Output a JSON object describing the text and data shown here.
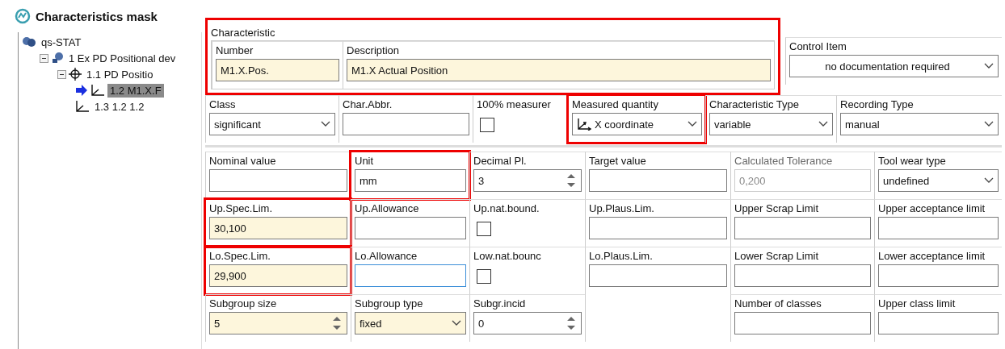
{
  "title": "Characteristics mask",
  "tree": [
    {
      "kind": "root",
      "label": "qs-STAT",
      "selected": false,
      "children": [
        {
          "kind": "part",
          "label": "1 Ex PD Positional dev",
          "selected": false,
          "expanded": true,
          "children": [
            {
              "kind": "process",
              "label": "1.1 PD Positio",
              "selected": false,
              "expanded": true,
              "children": [
                {
                  "kind": "characteristic",
                  "label": "1.2 M1.X.F",
                  "selected": true
                },
                {
                  "kind": "characteristic",
                  "label": "1.3 1.2 1.2",
                  "selected": false
                }
              ]
            }
          ]
        }
      ]
    }
  ],
  "characteristic_group": {
    "legend": "Characteristic",
    "highlighted": true,
    "fields": [
      {
        "kind": "text",
        "label": "Number",
        "value": "M1.X.Pos.",
        "required": true
      },
      {
        "kind": "text",
        "label": "Description",
        "value": "M1.X Actual Position",
        "required": true
      }
    ]
  },
  "control_item": {
    "kind": "select",
    "label": "Control Item",
    "value": "no documentation required",
    "centered": true
  },
  "row_2": [
    {
      "kind": "select",
      "label": "Class",
      "value": "significant"
    },
    {
      "kind": "text",
      "label": "Char.Abbr."
    },
    {
      "kind": "checkbox",
      "label": "100% measurer",
      "checked": false
    },
    {
      "kind": "select",
      "label": "Measured quantity",
      "value": "X coordinate",
      "axis_icon": true,
      "highlighted": true
    },
    {
      "kind": "select",
      "label": "Characteristic Type",
      "value": "variable"
    },
    {
      "kind": "select",
      "label": "Recording Type",
      "value": "manual"
    }
  ],
  "grid": [
    [
      {
        "kind": "text",
        "label": "Nominal value"
      },
      {
        "kind": "text",
        "label": "Unit",
        "value": "mm",
        "highlighted": true
      },
      {
        "kind": "spin",
        "label": "Decimal Pl.",
        "value": "3"
      },
      {
        "kind": "text",
        "label": "Target value"
      },
      {
        "kind": "text",
        "label": "Calculated Tolerance",
        "value": "0,200",
        "disabled": true
      },
      {
        "kind": "select",
        "label": "Tool wear type",
        "value": "undefined"
      }
    ],
    [
      {
        "kind": "text",
        "label": "Up.Spec.Lim.",
        "value": "30,100",
        "required": true,
        "highlighted": true
      },
      {
        "kind": "text",
        "label": "Up.Allowance"
      },
      {
        "kind": "checkbox",
        "label": "Up.nat.bound.",
        "checked": false
      },
      {
        "kind": "text",
        "label": "Up.Plaus.Lim."
      },
      {
        "kind": "text",
        "label": "Upper Scrap Limit"
      },
      {
        "kind": "text",
        "label": "Upper acceptance limit"
      }
    ],
    [
      {
        "kind": "text",
        "label": "Lo.Spec.Lim.",
        "value": "29,900",
        "required": true,
        "highlighted": true
      },
      {
        "kind": "text",
        "label": "Lo.Allowance",
        "focused": true
      },
      {
        "kind": "checkbox",
        "label": "Low.nat.bounc",
        "checked": false
      },
      {
        "kind": "text",
        "label": "Lo.Plaus.Lim."
      },
      {
        "kind": "text",
        "label": "Lower Scrap Limit"
      },
      {
        "kind": "text",
        "label": "Lower acceptance limit"
      }
    ],
    [
      {
        "kind": "spin",
        "label": "Subgroup size",
        "value": "5",
        "required": true
      },
      {
        "kind": "select",
        "label": "Subgroup type",
        "value": "fixed",
        "required": true
      },
      {
        "kind": "spin",
        "label": "Subgr.incid",
        "value": "0"
      },
      {
        "kind": "blank"
      },
      {
        "kind": "text",
        "label": "Number of classes"
      },
      {
        "kind": "text",
        "label": "Upper class limit"
      }
    ]
  ]
}
